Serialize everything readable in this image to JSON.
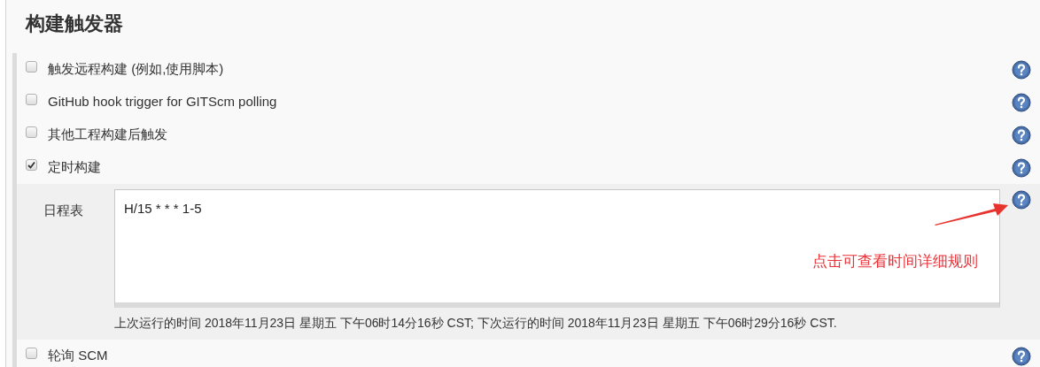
{
  "title": "构建触发器",
  "triggers": [
    {
      "kind": "checkbox",
      "label": "触发远程构建 (例如,使用脚本)",
      "checked": false
    },
    {
      "kind": "checkbox",
      "label": "GitHub hook trigger for GITScm polling",
      "checked": false
    },
    {
      "kind": "checkbox",
      "label": "其他工程构建后触发",
      "checked": false
    },
    {
      "kind": "checkbox",
      "label": "定时构建",
      "checked": true
    },
    {
      "kind": "schedule",
      "label": "日程表",
      "value": "H/15 * * * 1-5",
      "info": "上次运行的时间 2018年11月23日 星期五 下午06时14分16秒 CST; 下次运行的时间 2018年11月23日 星期五 下午06时29分16秒 CST."
    },
    {
      "kind": "checkbox",
      "label": "轮询 SCM",
      "checked": false
    }
  ],
  "annotation": {
    "text": "点击可查看时间详细规则"
  }
}
